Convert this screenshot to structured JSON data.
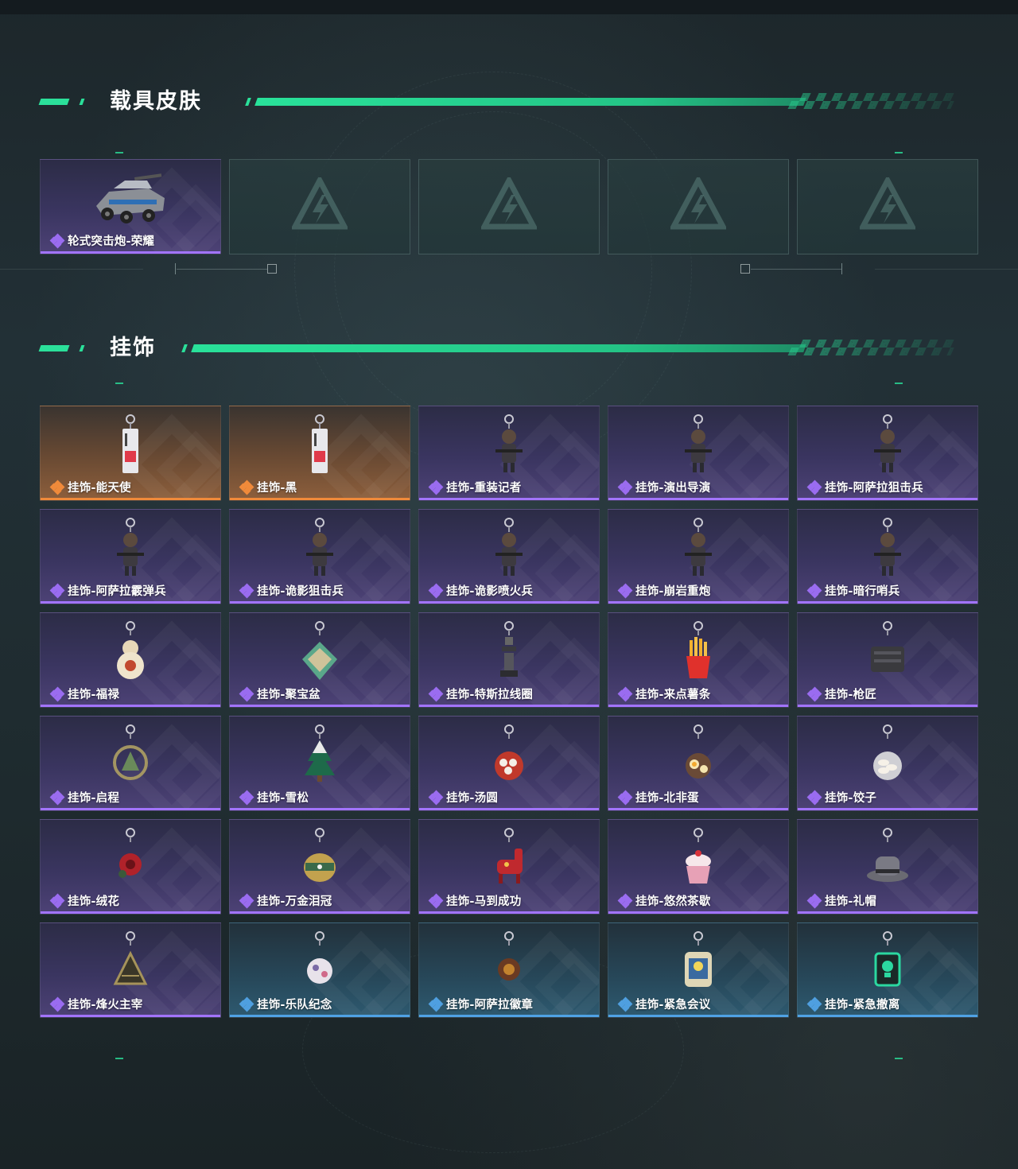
{
  "sections": {
    "vehicle": {
      "title": "载具皮肤"
    },
    "charm": {
      "title": "挂饰"
    }
  },
  "colors": {
    "accent": "#2be09a",
    "rarity_purple": "#a274ff",
    "rarity_orange": "#f08a3a",
    "rarity_blue": "#4fa2e4"
  },
  "vehicle_items": [
    {
      "name": "轮式突击炮-荣耀",
      "rarity": "purple",
      "icon": "armored-vehicle-icon"
    },
    {
      "empty": true,
      "icon": "game-logo-icon"
    },
    {
      "empty": true,
      "icon": "game-logo-icon"
    },
    {
      "empty": true,
      "icon": "game-logo-icon"
    },
    {
      "empty": true,
      "icon": "game-logo-icon"
    }
  ],
  "charm_items": [
    {
      "name": "挂饰-能天使",
      "rarity": "orange",
      "icon": "tag-charm-icon"
    },
    {
      "name": "挂饰-黑",
      "rarity": "orange",
      "icon": "tag-charm-icon"
    },
    {
      "name": "挂饰-重装记者",
      "rarity": "purple",
      "icon": "figure-charm-icon"
    },
    {
      "name": "挂饰-演出导演",
      "rarity": "purple",
      "icon": "figure-charm-icon"
    },
    {
      "name": "挂饰-阿萨拉狙击兵",
      "rarity": "purple",
      "icon": "figure-charm-icon"
    },
    {
      "name": "挂饰-阿萨拉霰弹兵",
      "rarity": "purple",
      "icon": "figure-charm-icon"
    },
    {
      "name": "挂饰-诡影狙击兵",
      "rarity": "purple",
      "icon": "figure-charm-icon"
    },
    {
      "name": "挂饰-诡影喷火兵",
      "rarity": "purple",
      "icon": "figure-charm-icon"
    },
    {
      "name": "挂饰-崩岩重炮",
      "rarity": "purple",
      "icon": "figure-charm-icon"
    },
    {
      "name": "挂饰-暗行哨兵",
      "rarity": "purple",
      "icon": "figure-charm-icon"
    },
    {
      "name": "挂饰-福禄",
      "rarity": "purple",
      "icon": "gourd-charm-icon"
    },
    {
      "name": "挂饰-聚宝盆",
      "rarity": "purple",
      "icon": "treasure-bowl-charm-icon"
    },
    {
      "name": "挂饰-特斯拉线圈",
      "rarity": "purple",
      "icon": "coil-charm-icon"
    },
    {
      "name": "挂饰-来点薯条",
      "rarity": "purple",
      "icon": "fries-charm-icon"
    },
    {
      "name": "挂饰-枪匠",
      "rarity": "purple",
      "icon": "gun-case-charm-icon"
    },
    {
      "name": "挂饰-启程",
      "rarity": "purple",
      "icon": "medallion-charm-icon"
    },
    {
      "name": "挂饰-雪松",
      "rarity": "purple",
      "icon": "tree-charm-icon"
    },
    {
      "name": "挂饰-汤圆",
      "rarity": "purple",
      "icon": "bowl-charm-icon"
    },
    {
      "name": "挂饰-北非蛋",
      "rarity": "purple",
      "icon": "pan-charm-icon"
    },
    {
      "name": "挂饰-饺子",
      "rarity": "purple",
      "icon": "dumpling-charm-icon"
    },
    {
      "name": "挂饰-绒花",
      "rarity": "purple",
      "icon": "flower-charm-icon"
    },
    {
      "name": "挂饰-万金泪冠",
      "rarity": "purple",
      "icon": "crown-charm-icon"
    },
    {
      "name": "挂饰-马到成功",
      "rarity": "purple",
      "icon": "horse-charm-icon"
    },
    {
      "name": "挂饰-悠然茶歇",
      "rarity": "purple",
      "icon": "cupcake-charm-icon"
    },
    {
      "name": "挂饰-礼帽",
      "rarity": "purple",
      "icon": "hat-charm-icon"
    },
    {
      "name": "挂饰-烽火主宰",
      "rarity": "purple",
      "icon": "triangle-charm-icon"
    },
    {
      "name": "挂饰-乐队纪念",
      "rarity": "blue",
      "icon": "badge-charm-icon"
    },
    {
      "name": "挂饰-阿萨拉徽章",
      "rarity": "blue",
      "icon": "emblem-charm-icon"
    },
    {
      "name": "挂饰-紧急会议",
      "rarity": "blue",
      "icon": "plaque-charm-icon"
    },
    {
      "name": "挂饰-紧急撤离",
      "rarity": "blue",
      "icon": "skull-tag-charm-icon"
    }
  ]
}
